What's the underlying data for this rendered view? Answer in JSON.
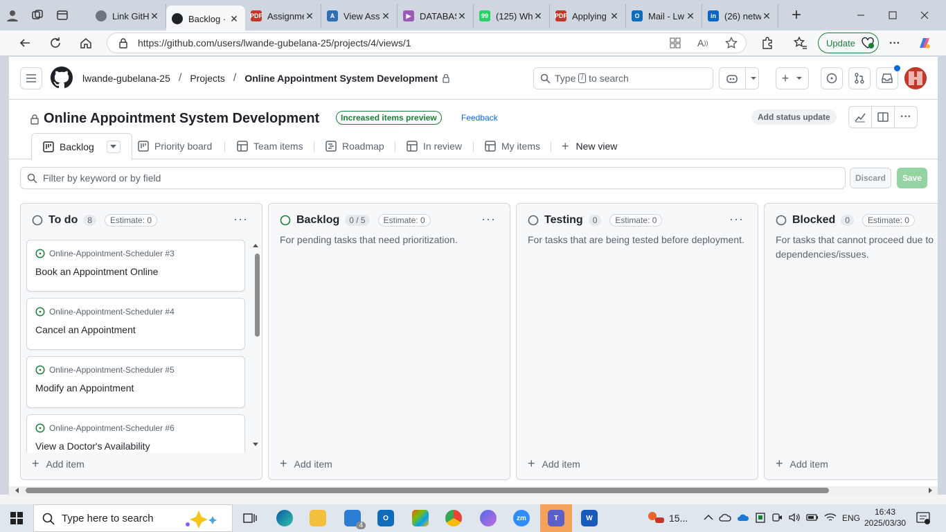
{
  "browser": {
    "tabs": [
      {
        "title": "Link GitH",
        "color": "#6e7781",
        "glyph": ""
      },
      {
        "title": "Backlog ·",
        "color": "#1f2328",
        "glyph": ""
      },
      {
        "title": "Assignme",
        "color": "#c0392b",
        "glyph": "PDF"
      },
      {
        "title": "View Asse",
        "color": "#2f6fb5",
        "glyph": "A"
      },
      {
        "title": "DATABAS",
        "color": "#9b59b6",
        "glyph": "▶"
      },
      {
        "title": "(125) Wh",
        "color": "#25d366",
        "glyph": "99"
      },
      {
        "title": "Applying",
        "color": "#c0392b",
        "glyph": "PDF"
      },
      {
        "title": "Mail - Lw",
        "color": "#0f6cbd",
        "glyph": "O"
      },
      {
        "title": "(26) netw",
        "color": "#0a66c2",
        "glyph": "in"
      }
    ],
    "url": "https://github.com/users/lwande-gubelana-25/projects/4/views/1",
    "update_label": "Update"
  },
  "github": {
    "breadcrumb": {
      "user": "lwande-gubelana-25",
      "projects": "Projects",
      "project": "Online Appointment System Development"
    },
    "search_type": "Type",
    "search_slash": "/",
    "search_rest": "to search",
    "project_title": "Online Appointment System Development",
    "preview_badge": "Increased items preview",
    "feedback": "Feedback",
    "status_update": "Add status update",
    "views": [
      {
        "label": "Backlog"
      },
      {
        "label": "Priority board"
      },
      {
        "label": "Team items"
      },
      {
        "label": "Roadmap"
      },
      {
        "label": "In review"
      },
      {
        "label": "My items"
      },
      {
        "label": "New view"
      }
    ],
    "filter_placeholder": "Filter by keyword or by field",
    "discard": "Discard",
    "save": "Save"
  },
  "board": {
    "columns": [
      {
        "name": "To do",
        "count": "8",
        "estimate": "Estimate: 0",
        "description": "",
        "add": "Add item",
        "status_color": "#59636e"
      },
      {
        "name": "Backlog",
        "count": "0 / 5",
        "estimate": "Estimate: 0",
        "description": "For pending tasks that need prioritization.",
        "add": "Add item",
        "status_color": "#1a7f37"
      },
      {
        "name": "Testing",
        "count": "0",
        "estimate": "Estimate: 0",
        "description": "For tasks that are being tested before deployment.",
        "add": "Add item",
        "status_color": "#59636e"
      },
      {
        "name": "Blocked",
        "count": "0",
        "estimate": "Estimate: 0",
        "description": "For tasks that cannot proceed due to dependencies/issues.",
        "add": "Add item",
        "status_color": "#59636e"
      }
    ],
    "cards": [
      {
        "ref": "Online-Appointment-Scheduler #3",
        "title": "Book an Appointment Online"
      },
      {
        "ref": "Online-Appointment-Scheduler #4",
        "title": "Cancel an Appointment"
      },
      {
        "ref": "Online-Appointment-Scheduler #5",
        "title": "Modify an Appointment"
      },
      {
        "ref": "Online-Appointment-Scheduler #6",
        "title": "View a Doctor's Availability"
      }
    ]
  },
  "taskbar": {
    "search_placeholder": "Type here to search",
    "mail_badge": "4",
    "weather": "15...",
    "language": "ENG",
    "time": "16:43",
    "date": "2025/03/30"
  },
  "colors": {
    "github_green": "#1a7f37",
    "link_blue": "#0969da",
    "edge_bg": "#cfd6df"
  }
}
